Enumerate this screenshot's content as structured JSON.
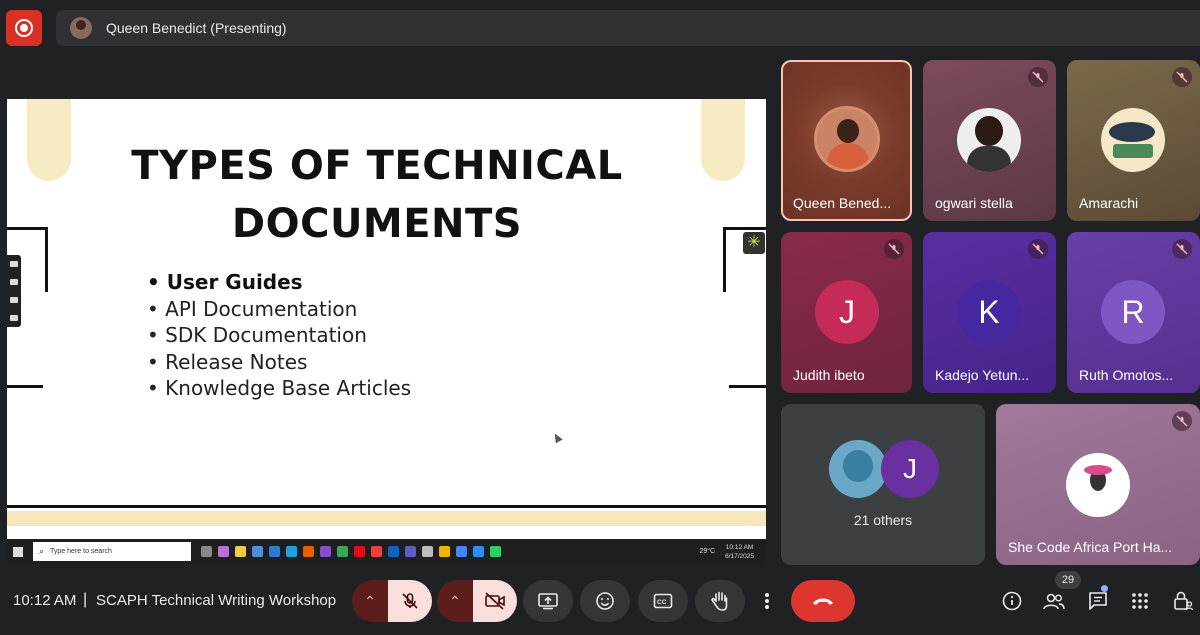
{
  "presenter_bar": {
    "label": "Queen Benedict (Presenting)"
  },
  "slide": {
    "title_line1": "TYPES OF TECHNICAL",
    "title_line2": "DOCUMENTS",
    "bullets": [
      "User Guides",
      "API Documentation",
      "SDK Documentation",
      "Release Notes",
      "Knowledge Base Articles"
    ]
  },
  "taskbar": {
    "search_placeholder": "Type here to search",
    "weather": "29°C",
    "time": "10:12 AM",
    "date": "6/17/2025"
  },
  "participants": [
    {
      "name": "Queen Bened...",
      "muted": false,
      "speaking": true
    },
    {
      "name": "ogwari stella",
      "muted": true
    },
    {
      "name": "Amarachi",
      "muted": true
    },
    {
      "name": "Judith ibeto",
      "initial": "J",
      "muted": true
    },
    {
      "name": "Kadejo Yetun...",
      "initial": "K",
      "muted": true
    },
    {
      "name": "Ruth Omotos...",
      "initial": "R",
      "muted": true
    }
  ],
  "others": {
    "label": "21 others",
    "initial": "J"
  },
  "she_code": {
    "name": "She Code Africa Port Ha...",
    "muted": true
  },
  "bottom_bar": {
    "time": "10:12 AM",
    "separator": "|",
    "meeting_name": "SCAPH Technical Writing Workshop",
    "participant_count": "29"
  },
  "colors": {
    "leave_red": "#dc362e",
    "muted_pink": "#f9dedc",
    "background": "#202124"
  }
}
